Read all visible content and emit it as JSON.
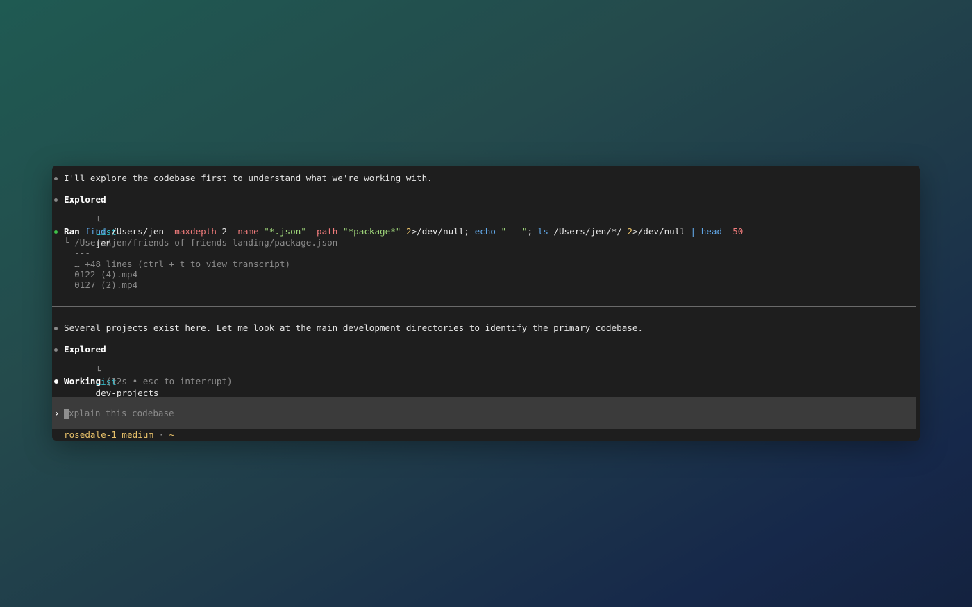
{
  "messages": {
    "intro": "I'll explore the codebase first to understand what we're working with.",
    "explored1": {
      "title": "Explored",
      "tree": "└",
      "action": "List",
      "target": "jen"
    },
    "ran": {
      "label": "Ran",
      "cmd": {
        "t1": "find",
        "t2": " /Users/jen ",
        "t3": "-maxdepth",
        "t4": " 2 ",
        "t5": "-name",
        "t6": " ",
        "t7": "\"*.json\"",
        "t8": " ",
        "t9": "-path",
        "t10": " ",
        "t11": "\"*package*\"",
        "t12": " ",
        "t13": "2",
        "t14": ">/dev/null; ",
        "t15": "echo",
        "t16": " ",
        "t17": "\"---\"",
        "t18": "; ",
        "t19": "ls",
        "t20": " /Users/jen/*/ ",
        "t21": "2",
        "t22": ">/dev/null ",
        "t23": "|",
        "t24": " ",
        "t25": "head",
        "t26": " ",
        "t27": "-50"
      },
      "output": [
        "└ /Users/jen/friends-of-friends-landing/package.json",
        "  ---",
        "  … +48 lines (ctrl + t to view transcript)",
        "  0122 (4).mp4",
        "  0127 (2).mp4"
      ]
    },
    "several": "Several projects exist here. Let me look at the main development directories to identify the primary codebase.",
    "explored2": {
      "title": "Explored",
      "tree": "└",
      "action": "List",
      "target": "dev-projects"
    },
    "working": {
      "label": "Working",
      "detail": "(12s • esc to interrupt)"
    }
  },
  "input": {
    "prompt": "›",
    "placeholder": "xplain this codebase"
  },
  "status": {
    "model": "rosedale-1 medium",
    "sep": " · ",
    "dir": "~"
  },
  "colors": {
    "background": "#1e1e1e",
    "accent_cyan": "#33b9c8",
    "accent_green": "#3fc24a",
    "status_yellow": "#e8c16a"
  }
}
